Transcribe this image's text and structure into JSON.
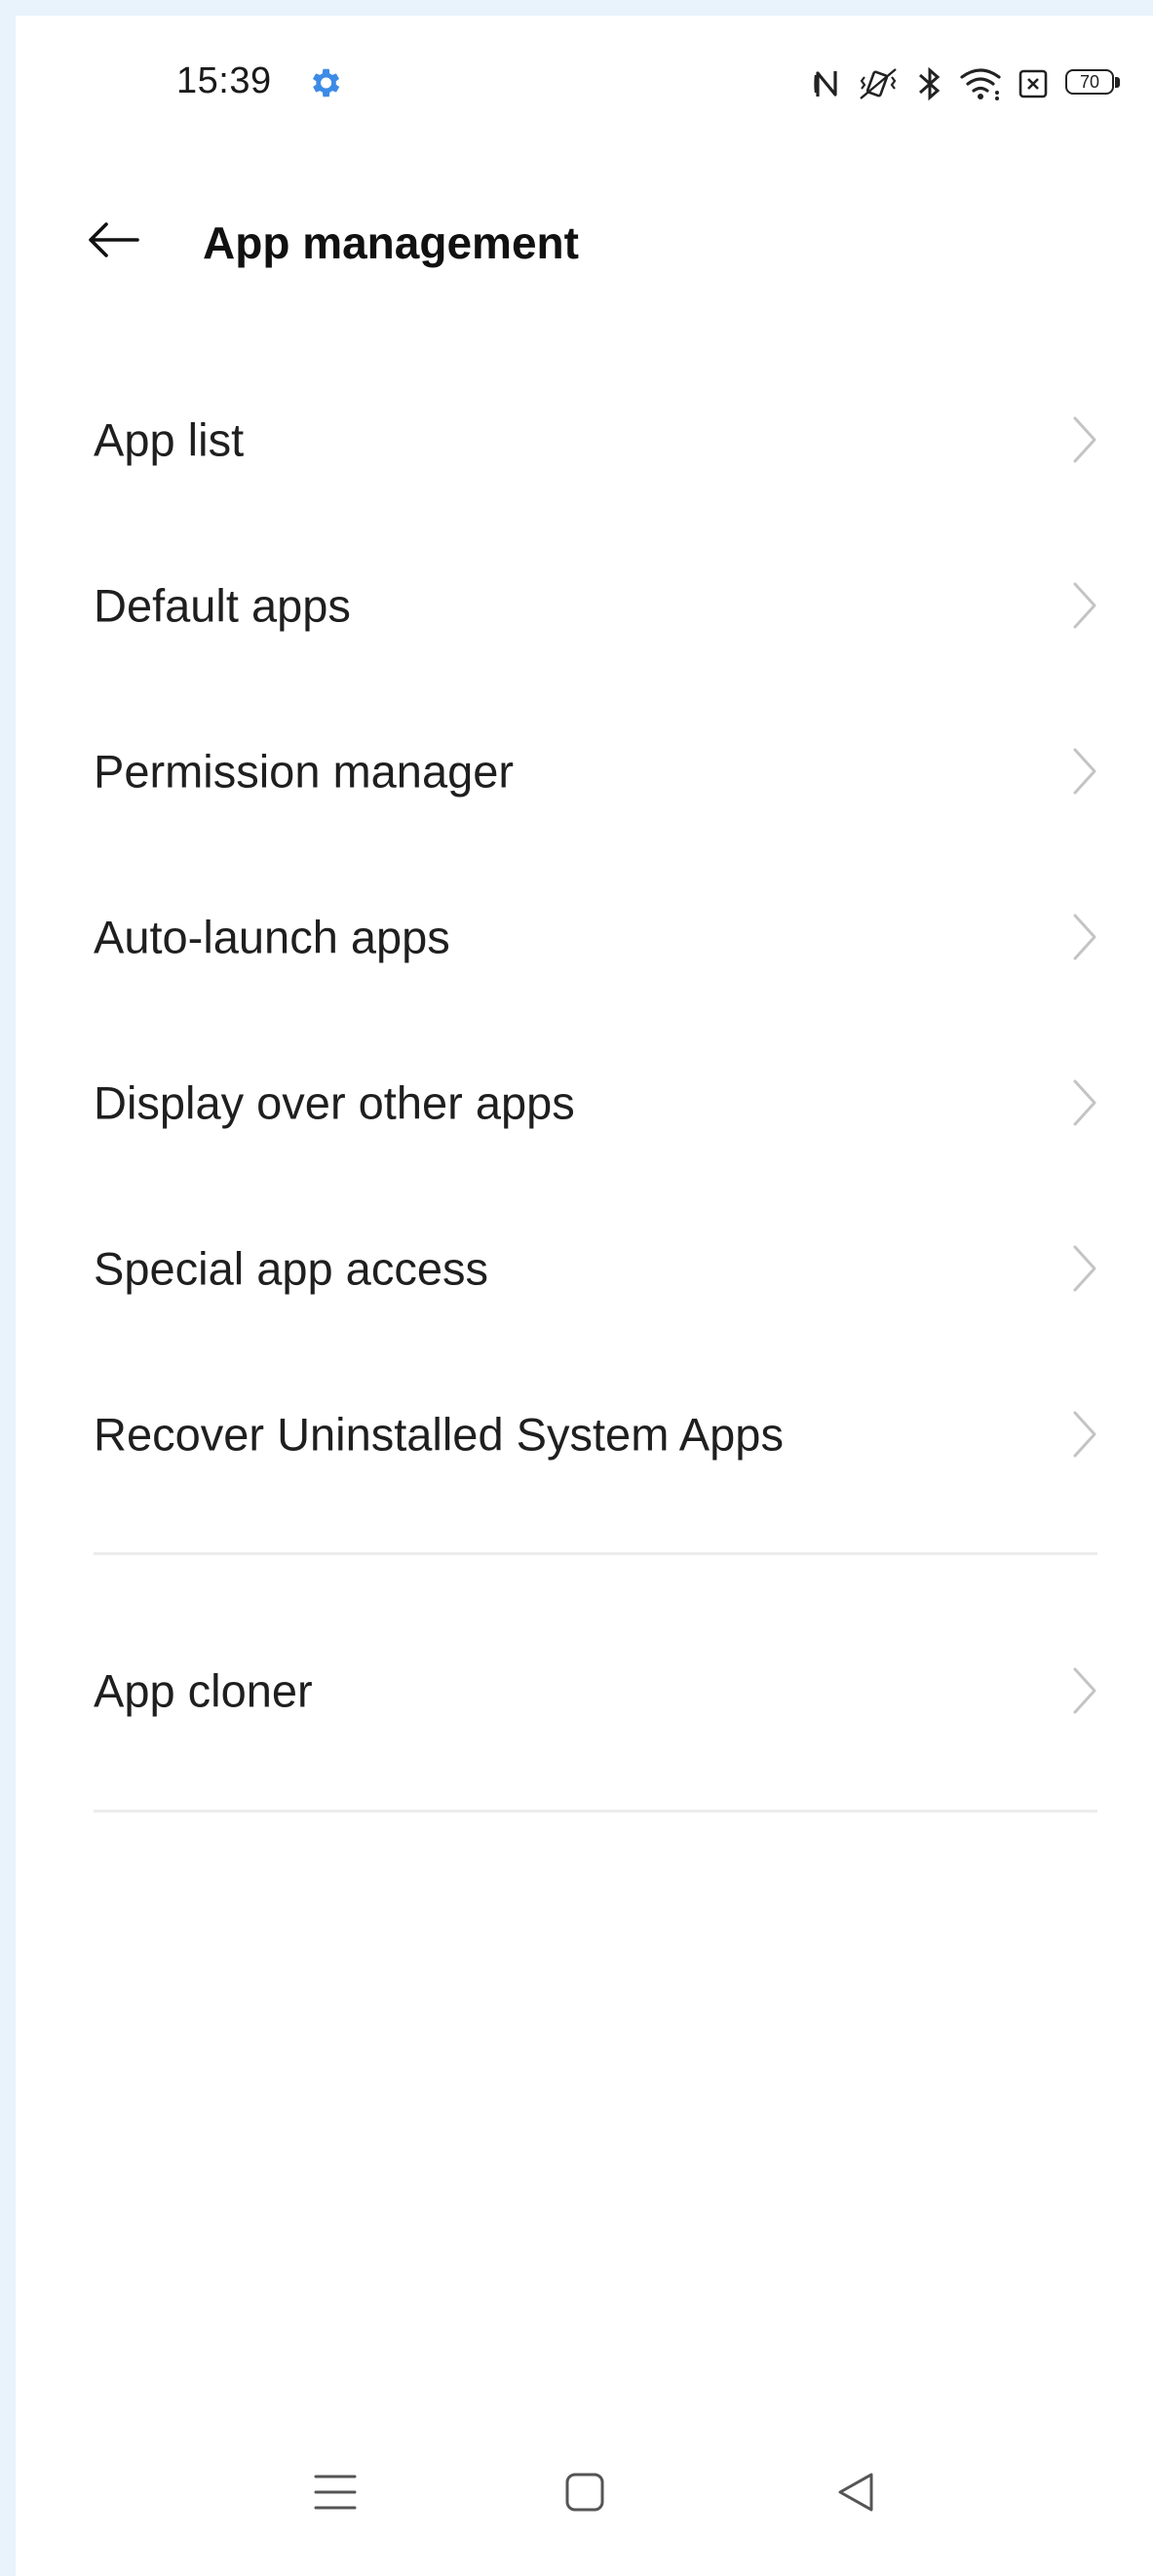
{
  "status_bar": {
    "time": "15:39",
    "battery_level": "70",
    "icons": [
      "settings-gear-icon",
      "nfc-icon",
      "vibrate-icon",
      "bluetooth-icon",
      "wifi-icon",
      "sim-icon",
      "battery-icon"
    ]
  },
  "header": {
    "title": "App management",
    "back_icon": "arrow-left-icon"
  },
  "menu": {
    "items": [
      {
        "label": "App list"
      },
      {
        "label": "Default apps"
      },
      {
        "label": "Permission manager"
      },
      {
        "label": "Auto-launch apps"
      },
      {
        "label": "Display over other apps"
      },
      {
        "label": "Special app access"
      },
      {
        "label": "Recover Uninstalled System Apps"
      },
      {
        "label": "App cloner"
      }
    ]
  },
  "nav_bar": {
    "icons": [
      "menu-icon",
      "home-icon",
      "back-triangle-icon"
    ]
  },
  "colors": {
    "accent": "#3d8be6",
    "frame": "#e8f3fb",
    "text": "#1f1f1f",
    "chevron": "#c4c4c4",
    "divider": "#ececec"
  }
}
